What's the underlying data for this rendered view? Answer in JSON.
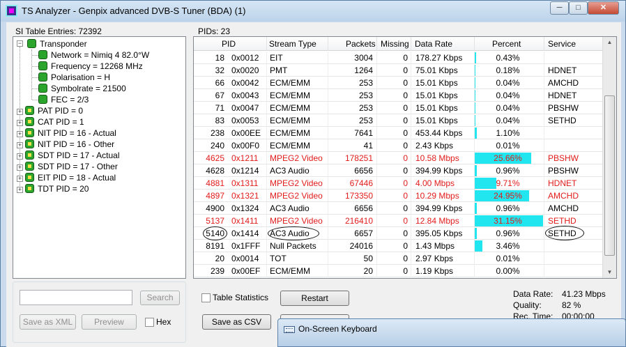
{
  "window": {
    "title": "TS Analyzer - Genpix advanced DVB-S Tuner (BDA) (1)",
    "controls": {
      "minimize": "─",
      "maximize": "□",
      "close": "✕"
    }
  },
  "left_panel": {
    "label": "SI Table Entries: 72392",
    "tree": {
      "root": "Transponder",
      "children": [
        "Network = Nimiq 4 82.0°W",
        "Frequency = 12268 MHz",
        "Polarisation = H",
        "Symbolrate = 21500",
        "FEC = 2/3"
      ],
      "tables": [
        {
          "label": "PAT PID = 0",
          "badge": "PA"
        },
        {
          "label": "CAT PID = 1",
          "badge": "CA"
        },
        {
          "label": "NIT PID = 16 - Actual",
          "badge": "NI"
        },
        {
          "label": "NIT PID = 16 - Other",
          "badge": "NI"
        },
        {
          "label": "SDT PID = 17 - Actual",
          "badge": "SD"
        },
        {
          "label": "SDT PID = 17 - Other",
          "badge": "SD"
        },
        {
          "label": "EIT PID = 18 - Actual",
          "badge": "EI"
        },
        {
          "label": "TDT PID = 20",
          "badge": "TD"
        }
      ]
    },
    "search_input": {
      "value": "",
      "placeholder": ""
    },
    "search_button": "Search",
    "save_xml_button": "Save as XML",
    "preview_button": "Preview",
    "hex_label": "Hex"
  },
  "right_panel": {
    "label": "PIDs: 23",
    "columns": [
      "PID",
      "Stream Type",
      "Packets",
      "Missing",
      "Data Rate",
      "Percent",
      "Service"
    ],
    "rows": [
      {
        "pid": "18",
        "hex": "0x0012",
        "type": "EIT",
        "packets": "3004",
        "missing": "0",
        "rate": "178.27 Kbps",
        "percent": "0.43%",
        "pct": 0.43,
        "service": "",
        "video": false
      },
      {
        "pid": "32",
        "hex": "0x0020",
        "type": "PMT",
        "packets": "1264",
        "missing": "0",
        "rate": "75.01 Kbps",
        "percent": "0.18%",
        "pct": 0.18,
        "service": "HDNET",
        "video": false
      },
      {
        "pid": "66",
        "hex": "0x0042",
        "type": "ECM/EMM",
        "packets": "253",
        "missing": "0",
        "rate": "15.01 Kbps",
        "percent": "0.04%",
        "pct": 0.04,
        "service": "AMCHD",
        "video": false
      },
      {
        "pid": "67",
        "hex": "0x0043",
        "type": "ECM/EMM",
        "packets": "253",
        "missing": "0",
        "rate": "15.01 Kbps",
        "percent": "0.04%",
        "pct": 0.04,
        "service": "HDNET",
        "video": false
      },
      {
        "pid": "71",
        "hex": "0x0047",
        "type": "ECM/EMM",
        "packets": "253",
        "missing": "0",
        "rate": "15.01 Kbps",
        "percent": "0.04%",
        "pct": 0.04,
        "service": "PBSHW",
        "video": false
      },
      {
        "pid": "83",
        "hex": "0x0053",
        "type": "ECM/EMM",
        "packets": "253",
        "missing": "0",
        "rate": "15.01 Kbps",
        "percent": "0.04%",
        "pct": 0.04,
        "service": "SETHD",
        "video": false
      },
      {
        "pid": "238",
        "hex": "0x00EE",
        "type": "ECM/EMM",
        "packets": "7641",
        "missing": "0",
        "rate": "453.44 Kbps",
        "percent": "1.10%",
        "pct": 1.1,
        "service": "",
        "video": false
      },
      {
        "pid": "240",
        "hex": "0x00F0",
        "type": "ECM/EMM",
        "packets": "41",
        "missing": "0",
        "rate": "2.43 Kbps",
        "percent": "0.01%",
        "pct": 0.01,
        "service": "",
        "video": false
      },
      {
        "pid": "4625",
        "hex": "0x1211",
        "type": "MPEG2 Video",
        "packets": "178251",
        "missing": "0",
        "rate": "10.58 Mbps",
        "percent": "25.66%",
        "pct": 25.66,
        "service": "PBSHW",
        "video": true
      },
      {
        "pid": "4628",
        "hex": "0x1214",
        "type": "AC3 Audio",
        "packets": "6656",
        "missing": "0",
        "rate": "394.99 Kbps",
        "percent": "0.96%",
        "pct": 0.96,
        "service": "PBSHW",
        "video": false
      },
      {
        "pid": "4881",
        "hex": "0x1311",
        "type": "MPEG2 Video",
        "packets": "67446",
        "missing": "0",
        "rate": "4.00 Mbps",
        "percent": "9.71%",
        "pct": 9.71,
        "service": "HDNET",
        "video": true
      },
      {
        "pid": "4897",
        "hex": "0x1321",
        "type": "MPEG2 Video",
        "packets": "173350",
        "missing": "0",
        "rate": "10.29 Mbps",
        "percent": "24.95%",
        "pct": 24.95,
        "service": "AMCHD",
        "video": true
      },
      {
        "pid": "4900",
        "hex": "0x1324",
        "type": "AC3 Audio",
        "packets": "6656",
        "missing": "0",
        "rate": "394.99 Kbps",
        "percent": "0.96%",
        "pct": 0.96,
        "service": "AMCHD",
        "video": false
      },
      {
        "pid": "5137",
        "hex": "0x1411",
        "type": "MPEG2 Video",
        "packets": "216410",
        "missing": "0",
        "rate": "12.84 Mbps",
        "percent": "31.15%",
        "pct": 31.15,
        "service": "SETHD",
        "video": true
      },
      {
        "pid": "5140",
        "hex": "0x1414",
        "type": "AC3 Audio",
        "packets": "6657",
        "missing": "0",
        "rate": "395.05 Kbps",
        "percent": "0.96%",
        "pct": 0.96,
        "service": "SETHD",
        "video": false
      },
      {
        "pid": "8191",
        "hex": "0x1FFF",
        "type": "Null Packets",
        "packets": "24016",
        "missing": "0",
        "rate": "1.43 Mbps",
        "percent": "3.46%",
        "pct": 3.46,
        "service": "",
        "video": false
      },
      {
        "pid": "20",
        "hex": "0x0014",
        "type": "TOT",
        "packets": "50",
        "missing": "0",
        "rate": "2.97 Kbps",
        "percent": "0.01%",
        "pct": 0.01,
        "service": "",
        "video": false
      },
      {
        "pid": "239",
        "hex": "0x00EF",
        "type": "ECM/EMM",
        "packets": "20",
        "missing": "0",
        "rate": "1.19 Kbps",
        "percent": "0.00%",
        "pct": 0.0,
        "service": "",
        "video": false
      }
    ],
    "table_statistics_label": "Table Statistics",
    "restart_button": "Restart",
    "save_csv_button": "Save as CSV"
  },
  "stats": {
    "data_rate_label": "Data Rate:",
    "data_rate_value": "41.23 Mbps",
    "quality_label": "Quality:",
    "quality_value": "82 %",
    "rec_time_label": "Rec. Time:",
    "rec_time_value": "00:00:00"
  },
  "taskbar": {
    "osk_title": "On-Screen Keyboard"
  },
  "colors": {
    "percent_bar": "#22e6ef",
    "video_row_text": "#e21b1b",
    "tree_bullet": "#2ca52c"
  }
}
